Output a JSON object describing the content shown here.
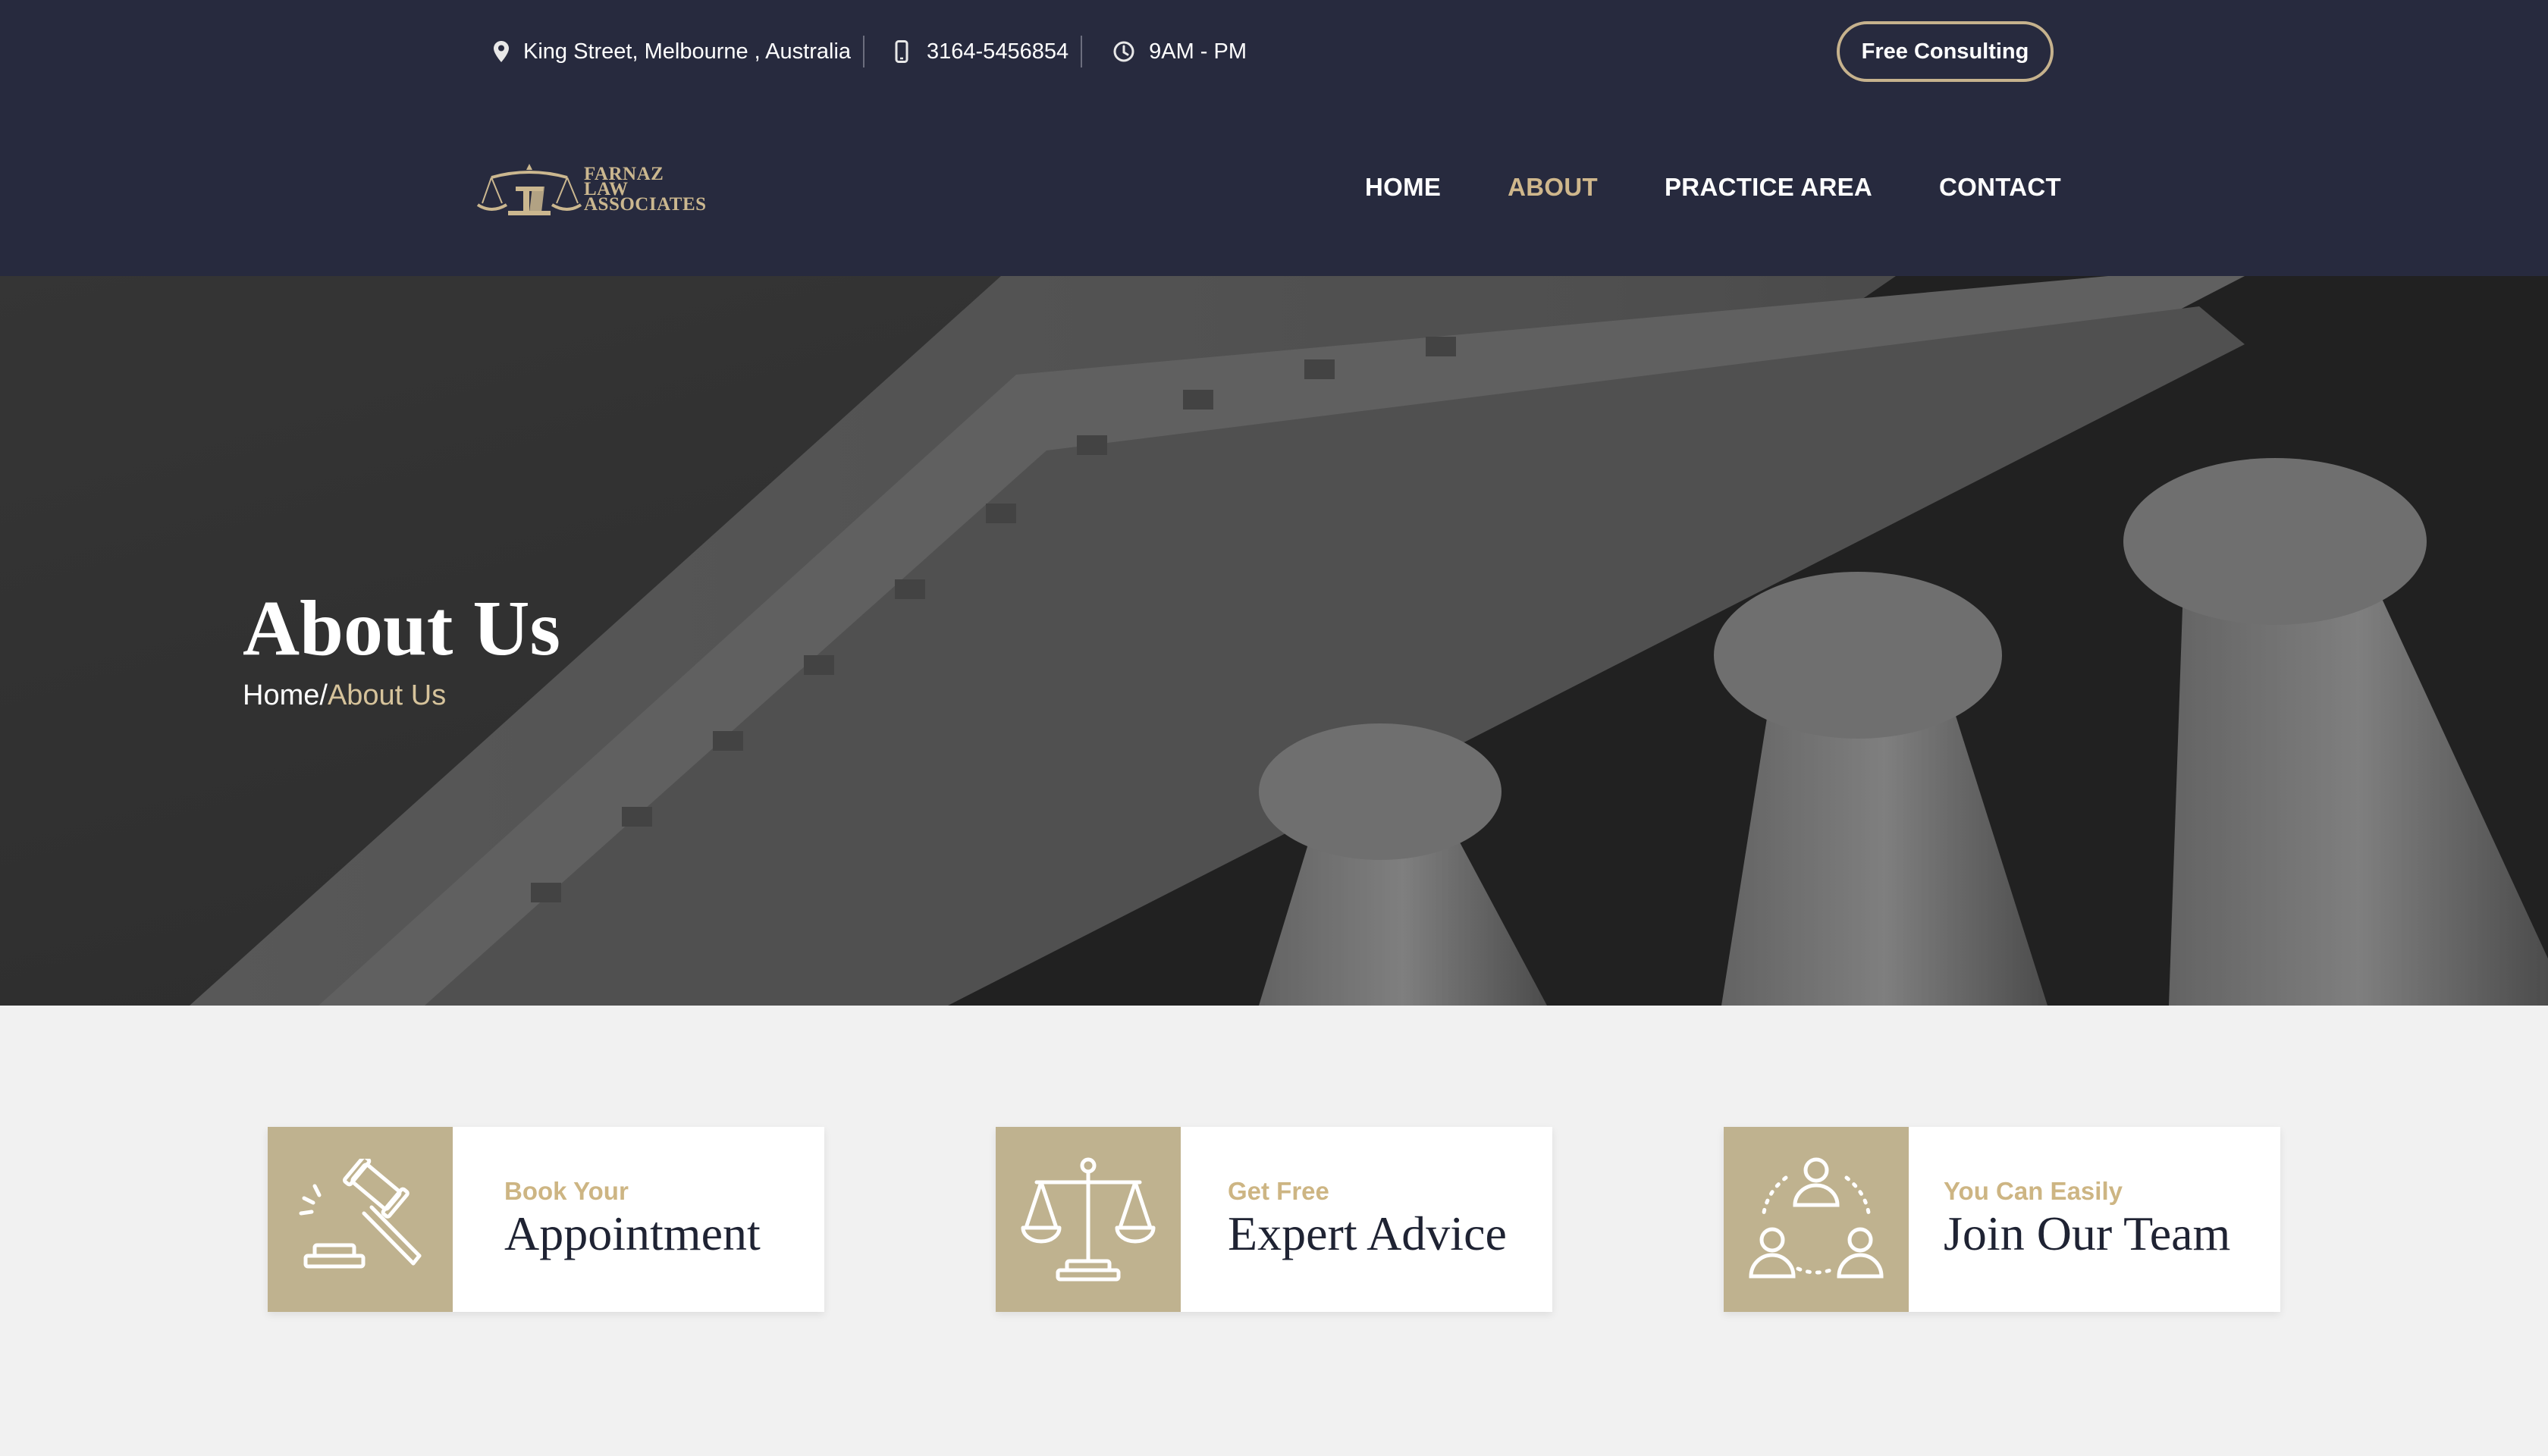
{
  "topbar": {
    "address": "King Street, Melbourne , Australia",
    "phone": "3164-5456854",
    "hours": "9AM - PM",
    "cta": "Free Consulting"
  },
  "logo": {
    "line1": "FARNAZ",
    "line2": "LAW",
    "line3": "ASSOCIATES"
  },
  "nav": {
    "items": [
      {
        "label": "HOME",
        "active": false
      },
      {
        "label": "ABOUT",
        "active": true
      },
      {
        "label": "PRACTICE AREA",
        "active": false
      },
      {
        "label": "CONTACT",
        "active": false
      }
    ]
  },
  "hero": {
    "title": "About Us",
    "breadcrumb": {
      "home": "Home",
      "separator": "/",
      "current": "About Us"
    }
  },
  "cards": [
    {
      "icon": "gavel-icon",
      "small": "Book Your",
      "big": "Appointment"
    },
    {
      "icon": "scales-icon",
      "small": "Get Free",
      "big": "Expert Advice"
    },
    {
      "icon": "team-icon",
      "small": "You Can Easily",
      "big": "Join Our Team"
    }
  ],
  "colors": {
    "header_bg": "#272a3e",
    "accent": "#cfb78c",
    "card_icon_bg": "#bfb28f",
    "page_bg": "#f1f1f1"
  }
}
